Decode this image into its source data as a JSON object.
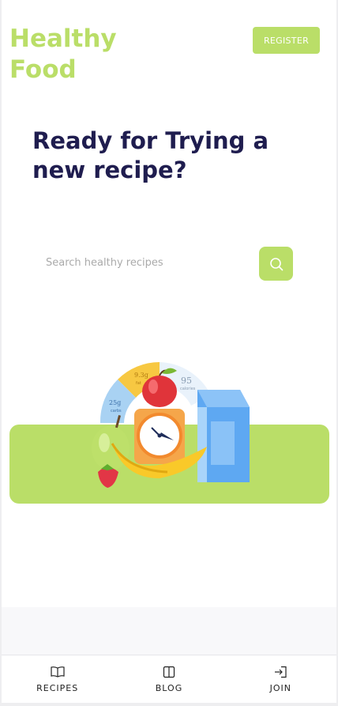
{
  "brand": {
    "line1": "Healthy",
    "line2": "Food"
  },
  "header": {
    "register_label": "REGISTER"
  },
  "hero": {
    "title": "Ready for Trying a new recipe?"
  },
  "search": {
    "placeholder": "Search healthy recipes"
  },
  "illustration": {
    "fat_value": "9.3g",
    "fat_label": "fat",
    "carbs_value": "25g",
    "carbs_label": "carbs",
    "calories_value": "95",
    "calories_label": "calories"
  },
  "tabs": [
    {
      "label": "RECIPES",
      "icon": "open-book-icon"
    },
    {
      "label": "BLOG",
      "icon": "notebook-icon"
    },
    {
      "label": "JOIN",
      "icon": "login-arrow-icon"
    }
  ],
  "colors": {
    "accent": "#bade68",
    "heading": "#1f1d4f"
  }
}
